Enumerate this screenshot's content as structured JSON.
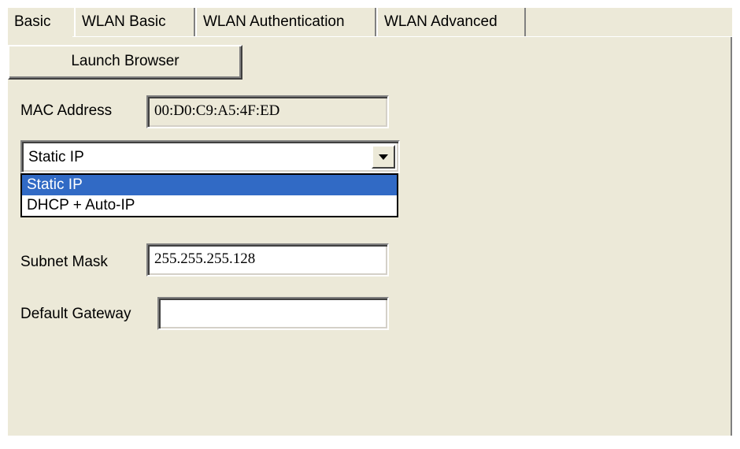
{
  "tabs": [
    {
      "label": "Basic",
      "active": true
    },
    {
      "label": "WLAN Basic",
      "active": false
    },
    {
      "label": "WLAN Authentication",
      "active": false
    },
    {
      "label": "WLAN Advanced",
      "active": false
    }
  ],
  "launch_button": {
    "label": "Launch Browser"
  },
  "mac": {
    "label": "MAC Address",
    "value": "00:D0:C9:A5:4F:ED"
  },
  "ip_mode": {
    "selected": "Static IP",
    "options": [
      {
        "label": "Static IP",
        "highlighted": true
      },
      {
        "label": "DHCP + Auto-IP",
        "highlighted": false
      }
    ]
  },
  "subnet": {
    "label": "Subnet Mask",
    "value": "255.255.255.128"
  },
  "gateway": {
    "label": "Default Gateway",
    "value": ""
  },
  "colors": {
    "panel": "#ece9d8",
    "selection": "#316ac5"
  },
  "icons": {
    "combo_arrow": "chevron-down-icon"
  }
}
